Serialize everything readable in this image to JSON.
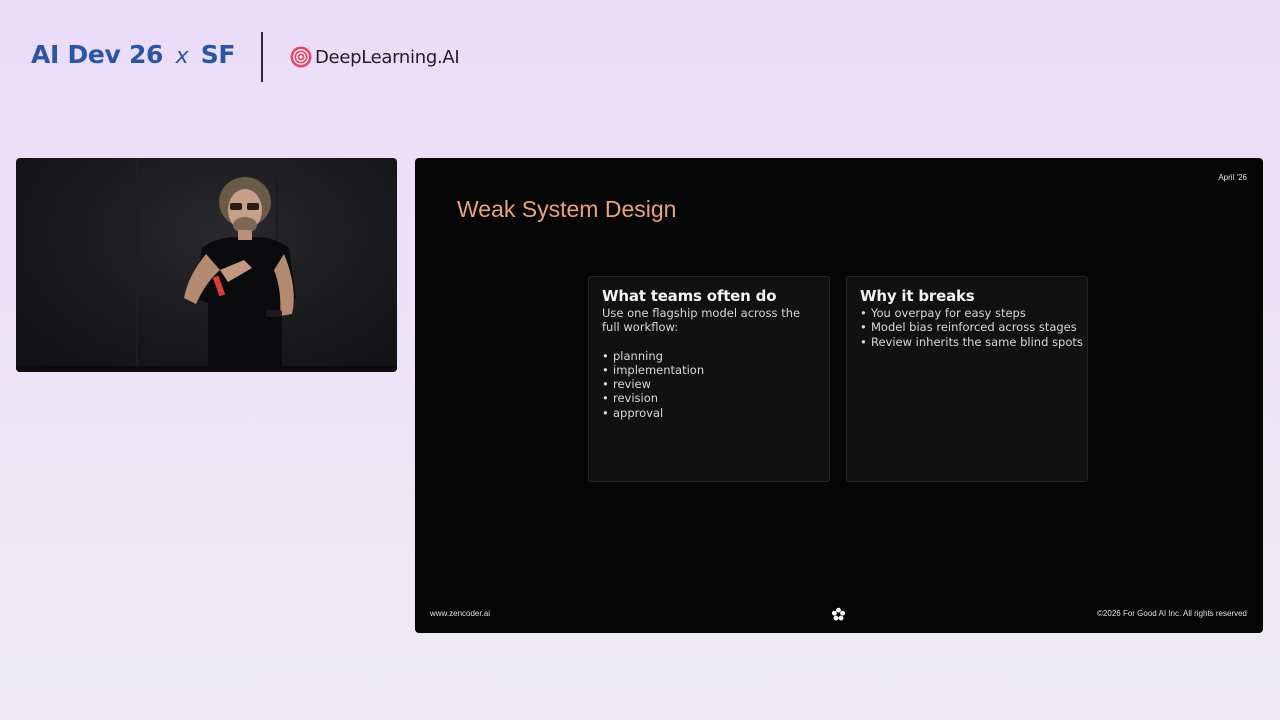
{
  "header": {
    "event_name": "AI Dev 26",
    "event_x": "x",
    "event_city": "SF",
    "partner_logo_text": "DeepLearning.AI"
  },
  "slide": {
    "date": "April '26",
    "title": "Weak System Design",
    "cards": [
      {
        "title": "What teams often do",
        "intro": "Use one flagship model across the full workflow:",
        "bullets": [
          "planning",
          "implementation",
          "review",
          "revision",
          "approval"
        ]
      },
      {
        "title": "Why it breaks",
        "intro": "",
        "bullets": [
          "You overpay for easy steps",
          "Model bias reinforced across stages",
          "Review inherits the same blind spots"
        ]
      }
    ],
    "footer_left": "www.zencoder.ai",
    "footer_right": "©2026 For Good AI Inc. All rights reserved"
  },
  "colors": {
    "event_logo": "#2c56a3",
    "slide_title": "#e9a27a",
    "dl_logo_mark": "#e8476a"
  },
  "icons": {
    "footer_center": "zencoder-flower-icon",
    "partner_mark": "deeplearning-ai-logo-mark"
  }
}
